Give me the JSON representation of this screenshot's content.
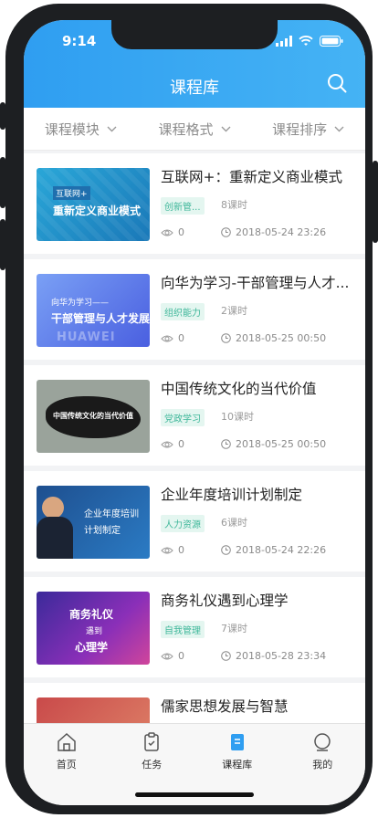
{
  "status_bar": {
    "time": "9:14"
  },
  "header": {
    "title": "课程库"
  },
  "filters": [
    {
      "label": "课程模块"
    },
    {
      "label": "课程格式"
    },
    {
      "label": "课程排序"
    }
  ],
  "courses": [
    {
      "title": "互联网+：重新定义商业模式",
      "tag": "创新管...",
      "lessons": "8课时",
      "views": "0",
      "date": "2018-05-24 23:26",
      "thumb_lines": [
        "互联网+",
        "重新定义商业模式"
      ]
    },
    {
      "title": "向华为学习-干部管理与人才...",
      "tag": "组织能力",
      "lessons": "2课时",
      "views": "0",
      "date": "2018-05-25 00:50",
      "thumb_lines": [
        "向华为学习——",
        "干部管理与人才发展",
        "HUAWEI"
      ]
    },
    {
      "title": "中国传统文化的当代价值",
      "tag": "党政学习",
      "lessons": "10课时",
      "views": "0",
      "date": "2018-05-25 00:50",
      "thumb_lines": [
        "中国传统文化的当代价值"
      ]
    },
    {
      "title": "企业年度培训计划制定",
      "tag": "人力资源",
      "lessons": "6课时",
      "views": "0",
      "date": "2018-05-24 22:26",
      "thumb_lines": [
        "企业年度培训",
        "计划制定"
      ]
    },
    {
      "title": "商务礼仪遇到心理学",
      "tag": "自我管理",
      "lessons": "7课时",
      "views": "0",
      "date": "2018-05-28 23:34",
      "thumb_lines": [
        "商务礼仪",
        "遇到",
        "心理学"
      ]
    },
    {
      "title": "儒家思想发展与智慧",
      "tag": "",
      "lessons": "",
      "views": "",
      "date": "",
      "thumb_lines": []
    }
  ],
  "tabbar": [
    {
      "label": "首页",
      "icon": "home-icon",
      "active": false
    },
    {
      "label": "任务",
      "icon": "task-icon",
      "active": false
    },
    {
      "label": "课程库",
      "icon": "course-library-icon",
      "active": true
    },
    {
      "label": "我的",
      "icon": "profile-icon",
      "active": false
    }
  ],
  "colors": {
    "accent": "#2f9ef1",
    "tag_green": "#3fb79a"
  }
}
